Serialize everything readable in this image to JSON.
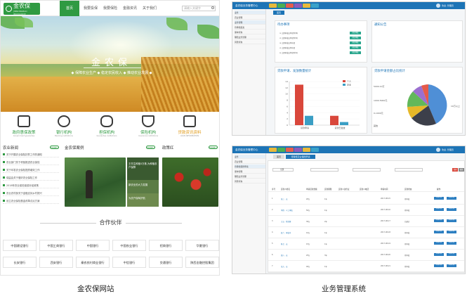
{
  "captions": {
    "left": "金农保网站",
    "right": "业务管理系统"
  },
  "site": {
    "logo": {
      "name": "金农保",
      "sub": "JINNONGBAO INSURANCE"
    },
    "nav": [
      "首页",
      "我要投保",
      "我要保险",
      "金融资讯",
      "关于我们"
    ],
    "search_placeholder": "请输入关键字",
    "hero": {
      "title": "金农保",
      "slogan": "◆ 保障农业生产 ◆ 稳定农民收入 ◆ 推动农业发展 ◆"
    },
    "services": [
      {
        "label": "政府惠保政策",
        "en": "Government guarantee",
        "icon": "government-icon"
      },
      {
        "label": "银行机构",
        "en": "Banking institutions",
        "icon": "piggy-bank-icon"
      },
      {
        "label": "担保机构",
        "en": "Guarantee institutions",
        "icon": "handshake-icon"
      },
      {
        "label": "保险机构",
        "en": "Insurance institutions",
        "icon": "shield-icon"
      },
      {
        "label": "贷款资讯资料",
        "en": "LOAN INFORMATION",
        "icon": "certificate-icon"
      }
    ],
    "sections": {
      "news": {
        "title": "农业新闻",
        "more": "MORE+"
      },
      "cases": {
        "title": "金农保案例",
        "more": "MORE+"
      },
      "market": {
        "title": "政策红",
        "more": "MORE+"
      }
    },
    "news_items": [
      "关于开展农业保险扶贫工作的通知",
      "农业部门关于积极推进农业保险",
      "关于印发农业保险提质增效工作",
      "保监会关于做好农业保险工作",
      "2018年农业保险保费补贴政策",
      "农业农村部关于金融支持乡村振兴",
      "设立农业保险基金改革试点方案"
    ],
    "case_text": {
      "a": "王先生种植5万株,为种植农户保障",
      "b": "新农业的大力发展",
      "c": "为农户保驾护航"
    },
    "partners_title": "合作伙伴",
    "partners": [
      "中国建设银行",
      "中国工商银行",
      "中国银行",
      "中国农业银行",
      "招商银行",
      "华夏银行",
      "长安银行",
      "西安银行",
      "秦农农村商业银行",
      "中信银行",
      "交通银行",
      "陕西金融控股集团"
    ]
  },
  "mgmt1": {
    "title": "金农保业务管理中心",
    "user": "欢迎, 管理员",
    "tab": "首页",
    "sidebar": [
      "业务",
      "农业管理",
      "业务管理",
      "待审核报案",
      "保单查询",
      "理赔业务管理",
      "风险查询"
    ],
    "todo": {
      "title": "待办事项",
      "items": [
        "① 立即审批出单/提单(6)",
        "② 立即审批出单/提单(2)",
        "③ 立即审批出单申请",
        "④ 立即审批出单申请",
        "⑤ 立即审批出单/提单(1)"
      ],
      "btn": "前往审核"
    },
    "notice": {
      "title": "通知公告"
    },
    "stats": {
      "title": "贷款申请、发放数量统计"
    },
    "pie_title": "贷款申请金额占比统计",
    "pie_labels": [
      "5000-10万",
      "1000-5000元",
      "0-1000元",
      "10万以上",
      "其他"
    ]
  },
  "chart_data": {
    "type": "bar",
    "categories": [
      "贷款申请",
      "贷款已发放"
    ],
    "series": [
      {
        "name": "个人",
        "values": [
          13,
          3
        ]
      },
      {
        "name": "企业",
        "values": [
          3,
          1
        ]
      }
    ],
    "ylim": [
      0,
      14
    ],
    "yticks": [
      "14",
      "12",
      "10",
      "8",
      "6",
      "4",
      "2",
      "0"
    ]
  },
  "mgmt2": {
    "title": "金农保业务管理中心",
    "user": "欢迎, 管理员",
    "tabs": [
      "首页",
      "待审核农业保险申请"
    ],
    "sidebar": [
      "业务",
      "农业管理",
      "待审核保险申请",
      "保单管理",
      "理赔业务管理",
      "风险查询"
    ],
    "filters": {
      "status": "全部",
      "search_btn": "查询",
      "reset_btn": "重置"
    },
    "headers": [
      "序号",
      "贷款人姓名",
      "申请贷款金额",
      "贷款期限",
      "贷款人身份证",
      "贷款人电话",
      "申请时间",
      "贷款状态",
      "操作"
    ],
    "rows": [
      {
        "no": "1",
        "name": "张三 · 无",
        "amt": "20万",
        "term": "1年",
        "time": "2017-08-15",
        "status": "待审核"
      },
      {
        "no": "2",
        "name": "李四 · 人工审核",
        "amt": "50万",
        "term": "1年",
        "time": "2017-08-16",
        "status": "待审核"
      },
      {
        "no": "3",
        "name": "王五 · 待处理",
        "amt": "30万",
        "term": "2年",
        "time": "2017-08-17",
        "status": "已通过"
      },
      {
        "no": "4",
        "name": "赵六 · 审核中",
        "amt": "10万",
        "term": "1年",
        "time": "2017-08-18",
        "status": "待审核"
      },
      {
        "no": "5",
        "name": "陈七 · 无",
        "amt": "15万",
        "term": "1年",
        "time": "2017-08-19",
        "status": "待审核"
      },
      {
        "no": "6",
        "name": "周八 · 无",
        "amt": "25万",
        "term": "3年",
        "time": "2017-08-20",
        "status": "待审核"
      },
      {
        "no": "7",
        "name": "吴九 · 无",
        "amt": "40万",
        "term": "1年",
        "time": "2017-08-21",
        "status": "待审核"
      }
    ],
    "row_btn": "审核详情"
  },
  "colors": {
    "green": "#2f9a42",
    "blue": "#1d74b6",
    "red": "#d9473b",
    "teal": "#3a9ec4"
  }
}
